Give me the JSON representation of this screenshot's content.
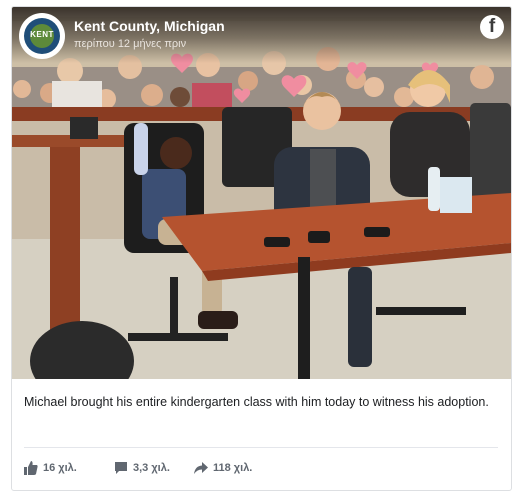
{
  "post": {
    "page_name": "Kent County, Michigan",
    "time": "περίπου 12 μήνες πριν",
    "logo_text": "KENT",
    "caption": "Michael brought his entire kindergarten class with him today to witness his adoption."
  },
  "photo": {
    "description_alt": ""
  },
  "stats": {
    "likes": "16 χιλ.",
    "comments": "3,3 χιλ.",
    "shares": "118 χιλ."
  },
  "icons": {
    "brand": "facebook-icon",
    "like": "thumbs-up-icon",
    "comment": "comment-icon",
    "share": "share-arrow-icon"
  },
  "colors": {
    "text": "#1c1e21",
    "meta": "#606770",
    "border": "#dddfe2",
    "table": "#b5532f"
  }
}
